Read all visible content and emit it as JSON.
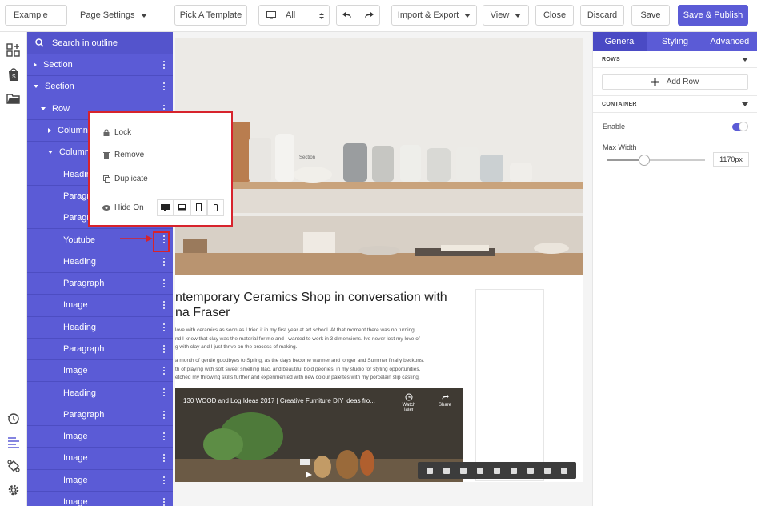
{
  "topbar": {
    "page_name": "Example",
    "page_settings": "Page Settings",
    "pick_template": "Pick A Template",
    "device_select": "All",
    "import_export": "Import & Export",
    "view": "View",
    "close": "Close",
    "discard": "Discard",
    "save": "Save",
    "save_publish": "Save & Publish"
  },
  "outline": {
    "search_placeholder": "Search in outline",
    "items": [
      {
        "label": "Section",
        "indent": 0,
        "arrow": "right"
      },
      {
        "label": "Section",
        "indent": 0,
        "arrow": "down"
      },
      {
        "label": "Row",
        "indent": 1,
        "arrow": "down"
      },
      {
        "label": "Column",
        "indent": 2,
        "arrow": "right"
      },
      {
        "label": "Column",
        "indent": 2,
        "arrow": "down"
      },
      {
        "label": "Heading",
        "indent": 3,
        "arrow": "none"
      },
      {
        "label": "Paragraph",
        "indent": 3,
        "arrow": "none"
      },
      {
        "label": "Paragraph",
        "indent": 3,
        "arrow": "none"
      },
      {
        "label": "Youtube",
        "indent": 3,
        "arrow": "none"
      },
      {
        "label": "Heading",
        "indent": 3,
        "arrow": "none"
      },
      {
        "label": "Paragraph",
        "indent": 3,
        "arrow": "none"
      },
      {
        "label": "Image",
        "indent": 3,
        "arrow": "none"
      },
      {
        "label": "Heading",
        "indent": 3,
        "arrow": "none"
      },
      {
        "label": "Paragraph",
        "indent": 3,
        "arrow": "none"
      },
      {
        "label": "Image",
        "indent": 3,
        "arrow": "none"
      },
      {
        "label": "Heading",
        "indent": 3,
        "arrow": "none"
      },
      {
        "label": "Paragraph",
        "indent": 3,
        "arrow": "none"
      },
      {
        "label": "Image",
        "indent": 3,
        "arrow": "none"
      },
      {
        "label": "Image",
        "indent": 3,
        "arrow": "none"
      },
      {
        "label": "Image",
        "indent": 3,
        "arrow": "none"
      },
      {
        "label": "Image",
        "indent": 3,
        "arrow": "none"
      }
    ]
  },
  "context_menu": {
    "lock": "Lock",
    "remove": "Remove",
    "duplicate": "Duplicate",
    "hide_on": "Hide On"
  },
  "canvas": {
    "section_label": "Section",
    "title": "ntemporary Ceramics Shop in conversation with\nna Fraser",
    "para1": " love with ceramics as soon as I tried it in my first year at art school. At that moment there was no turning\nnd I knew that clay was the material for me and I wanted to work in 3 dimensions. Ive never lost my love of\ng with clay and I just thrive on the process of making.",
    "para2": "a month of gentle goodbyes to Spring, as the days become warmer and longer and Summer finally beckons.\nth of playing with soft sweet smelling lilac, and beautiful bold peonies, in my studio for styling opportunities.\netched my throwing skills further and experimented with new colour palettes with my porcelain slip casting.",
    "video_title": "130 WOOD and Log Ideas 2017 | Creative Furniture DIY ideas fro...",
    "watch_later": "Watch later",
    "share": "Share"
  },
  "settings": {
    "tabs": [
      "General",
      "Styling",
      "Advanced"
    ],
    "rows_header": "ROWS",
    "add_row": "Add Row",
    "container_header": "CONTAINER",
    "enable_label": "Enable",
    "enable_on": true,
    "max_width_label": "Max Width",
    "max_width_value": "1170px",
    "max_width_slider": 0.38
  },
  "colors": {
    "primary": "#5b5bd6",
    "highlight": "#d7232c"
  }
}
